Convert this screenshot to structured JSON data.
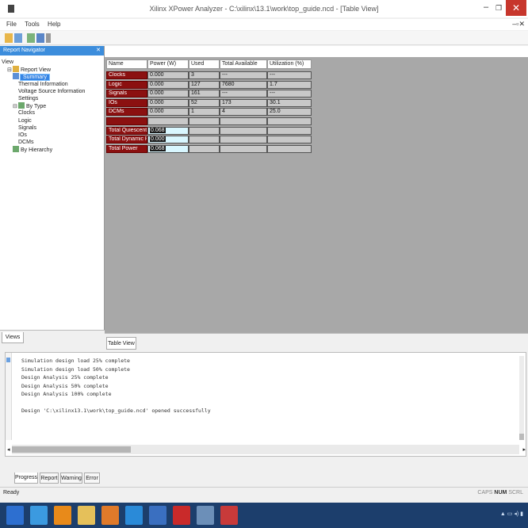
{
  "window": {
    "title": "Xilinx XPower Analyzer - C:\\xilinx\\13.1\\work\\top_guide.ncd - [Table View]"
  },
  "menu": {
    "items": [
      "File",
      "Tools",
      "Help"
    ]
  },
  "left_panel": {
    "header": "Report Navigator",
    "tree": [
      {
        "label": "View",
        "level": 0,
        "icon": "none",
        "expander": ""
      },
      {
        "label": "Report View",
        "level": 1,
        "icon": "folder-icon",
        "expander": "⊟"
      },
      {
        "label": "Summary",
        "level": 2,
        "icon": "report-icon",
        "expander": "",
        "selected": true
      },
      {
        "label": "Thermal Information",
        "level": 3,
        "icon": "none",
        "expander": ""
      },
      {
        "label": "Voltage Source Information",
        "level": 3,
        "icon": "none",
        "expander": ""
      },
      {
        "label": "Settings",
        "level": 3,
        "icon": "none",
        "expander": ""
      },
      {
        "label": "By Type",
        "level": 2,
        "icon": "table-icon",
        "expander": "⊟"
      },
      {
        "label": "Clocks",
        "level": 3,
        "icon": "none",
        "expander": ""
      },
      {
        "label": "Logic",
        "level": 3,
        "icon": "none",
        "expander": ""
      },
      {
        "label": "Signals",
        "level": 3,
        "icon": "none",
        "expander": ""
      },
      {
        "label": "IOs",
        "level": 3,
        "icon": "none",
        "expander": ""
      },
      {
        "label": "DCMs",
        "level": 3,
        "icon": "none",
        "expander": ""
      },
      {
        "label": "By Hierarchy",
        "level": 2,
        "icon": "table-icon",
        "expander": ""
      }
    ],
    "tab": "Views"
  },
  "table": {
    "headers": [
      "Name",
      "Power (W)",
      "Used",
      "Total Available",
      "Utilization (%)"
    ],
    "rows": [
      {
        "name": "Clocks",
        "power": "0.000",
        "used": "3",
        "total": "---",
        "util": "---"
      },
      {
        "name": "Logic",
        "power": "0.000",
        "used": "127",
        "total": "7680",
        "util": "1.7"
      },
      {
        "name": "Signals",
        "power": "0.000",
        "used": "161",
        "total": "---",
        "util": "---"
      },
      {
        "name": "IOs",
        "power": "0.000",
        "used": "52",
        "total": "173",
        "util": "30.1"
      },
      {
        "name": "DCMs",
        "power": "0.000",
        "used": "1",
        "total": "4",
        "util": "25.0"
      }
    ],
    "power_rows": [
      {
        "name": "Total Quiescent Power",
        "value": "0.068"
      },
      {
        "name": "Total Dynamic Power",
        "value": "0.000"
      },
      {
        "name": "Total Power",
        "value": "0.068"
      }
    ]
  },
  "doc_tab": "Table View",
  "console": {
    "lines": [
      "Simulation design load 25% complete",
      "Simulation design load 50% complete",
      "Design Analysis 25% complete",
      "Design Analysis 50% complete",
      "Design Analysis 100% complete",
      "",
      "Design 'C:\\xilinx13.1\\work\\top_guide.ncd' opened successfully"
    ]
  },
  "bottom_tabs": [
    "Progress",
    "Report",
    "Warning",
    "Error"
  ],
  "status": {
    "left": "Ready",
    "right_dim": "CAPS",
    "right_bold": "NUM",
    "right_end": "SCRL"
  },
  "colors": {
    "row_label": "#8b1010",
    "selection": "#3584e4",
    "taskbar": "#1c3e6c",
    "close": "#c7362c"
  }
}
